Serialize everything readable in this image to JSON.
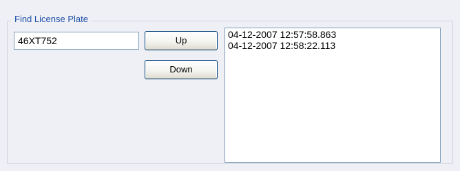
{
  "group": {
    "title": "Find License Plate"
  },
  "search": {
    "value": "46XT752"
  },
  "buttons": {
    "up_label": "Up",
    "down_label": "Down"
  },
  "results": {
    "items": [
      "04-12-2007 12:57:58.863",
      "04-12-2007 12:58:22.113"
    ]
  },
  "colors": {
    "background": "#eef0f6",
    "group_title": "#1f4fa8",
    "control_border": "#7f9db9",
    "button_border": "#003c74"
  }
}
